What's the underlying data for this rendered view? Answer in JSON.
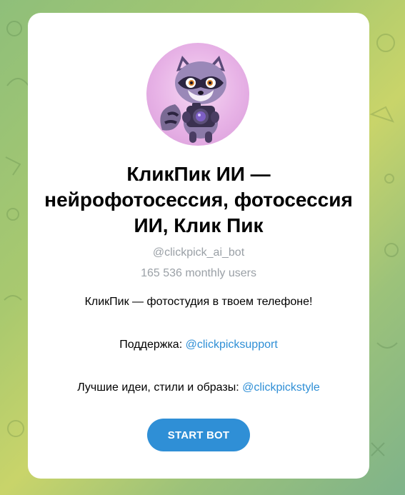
{
  "bot": {
    "title": "КликПик ИИ — нейрофотосессия, фотосессия ИИ, Клик Пик",
    "username": "@clickpick_ai_bot",
    "monthly_users": "165 536 monthly users",
    "description": "КликПик — фотостудия в твоем телефоне!",
    "support_label": "Поддержка: ",
    "support_link": "@clickpicksupport",
    "ideas_label": "Лучшие идеи, стили и образы: ",
    "ideas_link": "@clickpickstyle",
    "start_button": "START BOT",
    "avatar_icon": "raccoon-with-camera-icon"
  },
  "colors": {
    "accent": "#2f8fd6",
    "muted_text": "#9aa0a6",
    "card_bg": "#ffffff",
    "avatar_bg": "#e7b2e6"
  }
}
